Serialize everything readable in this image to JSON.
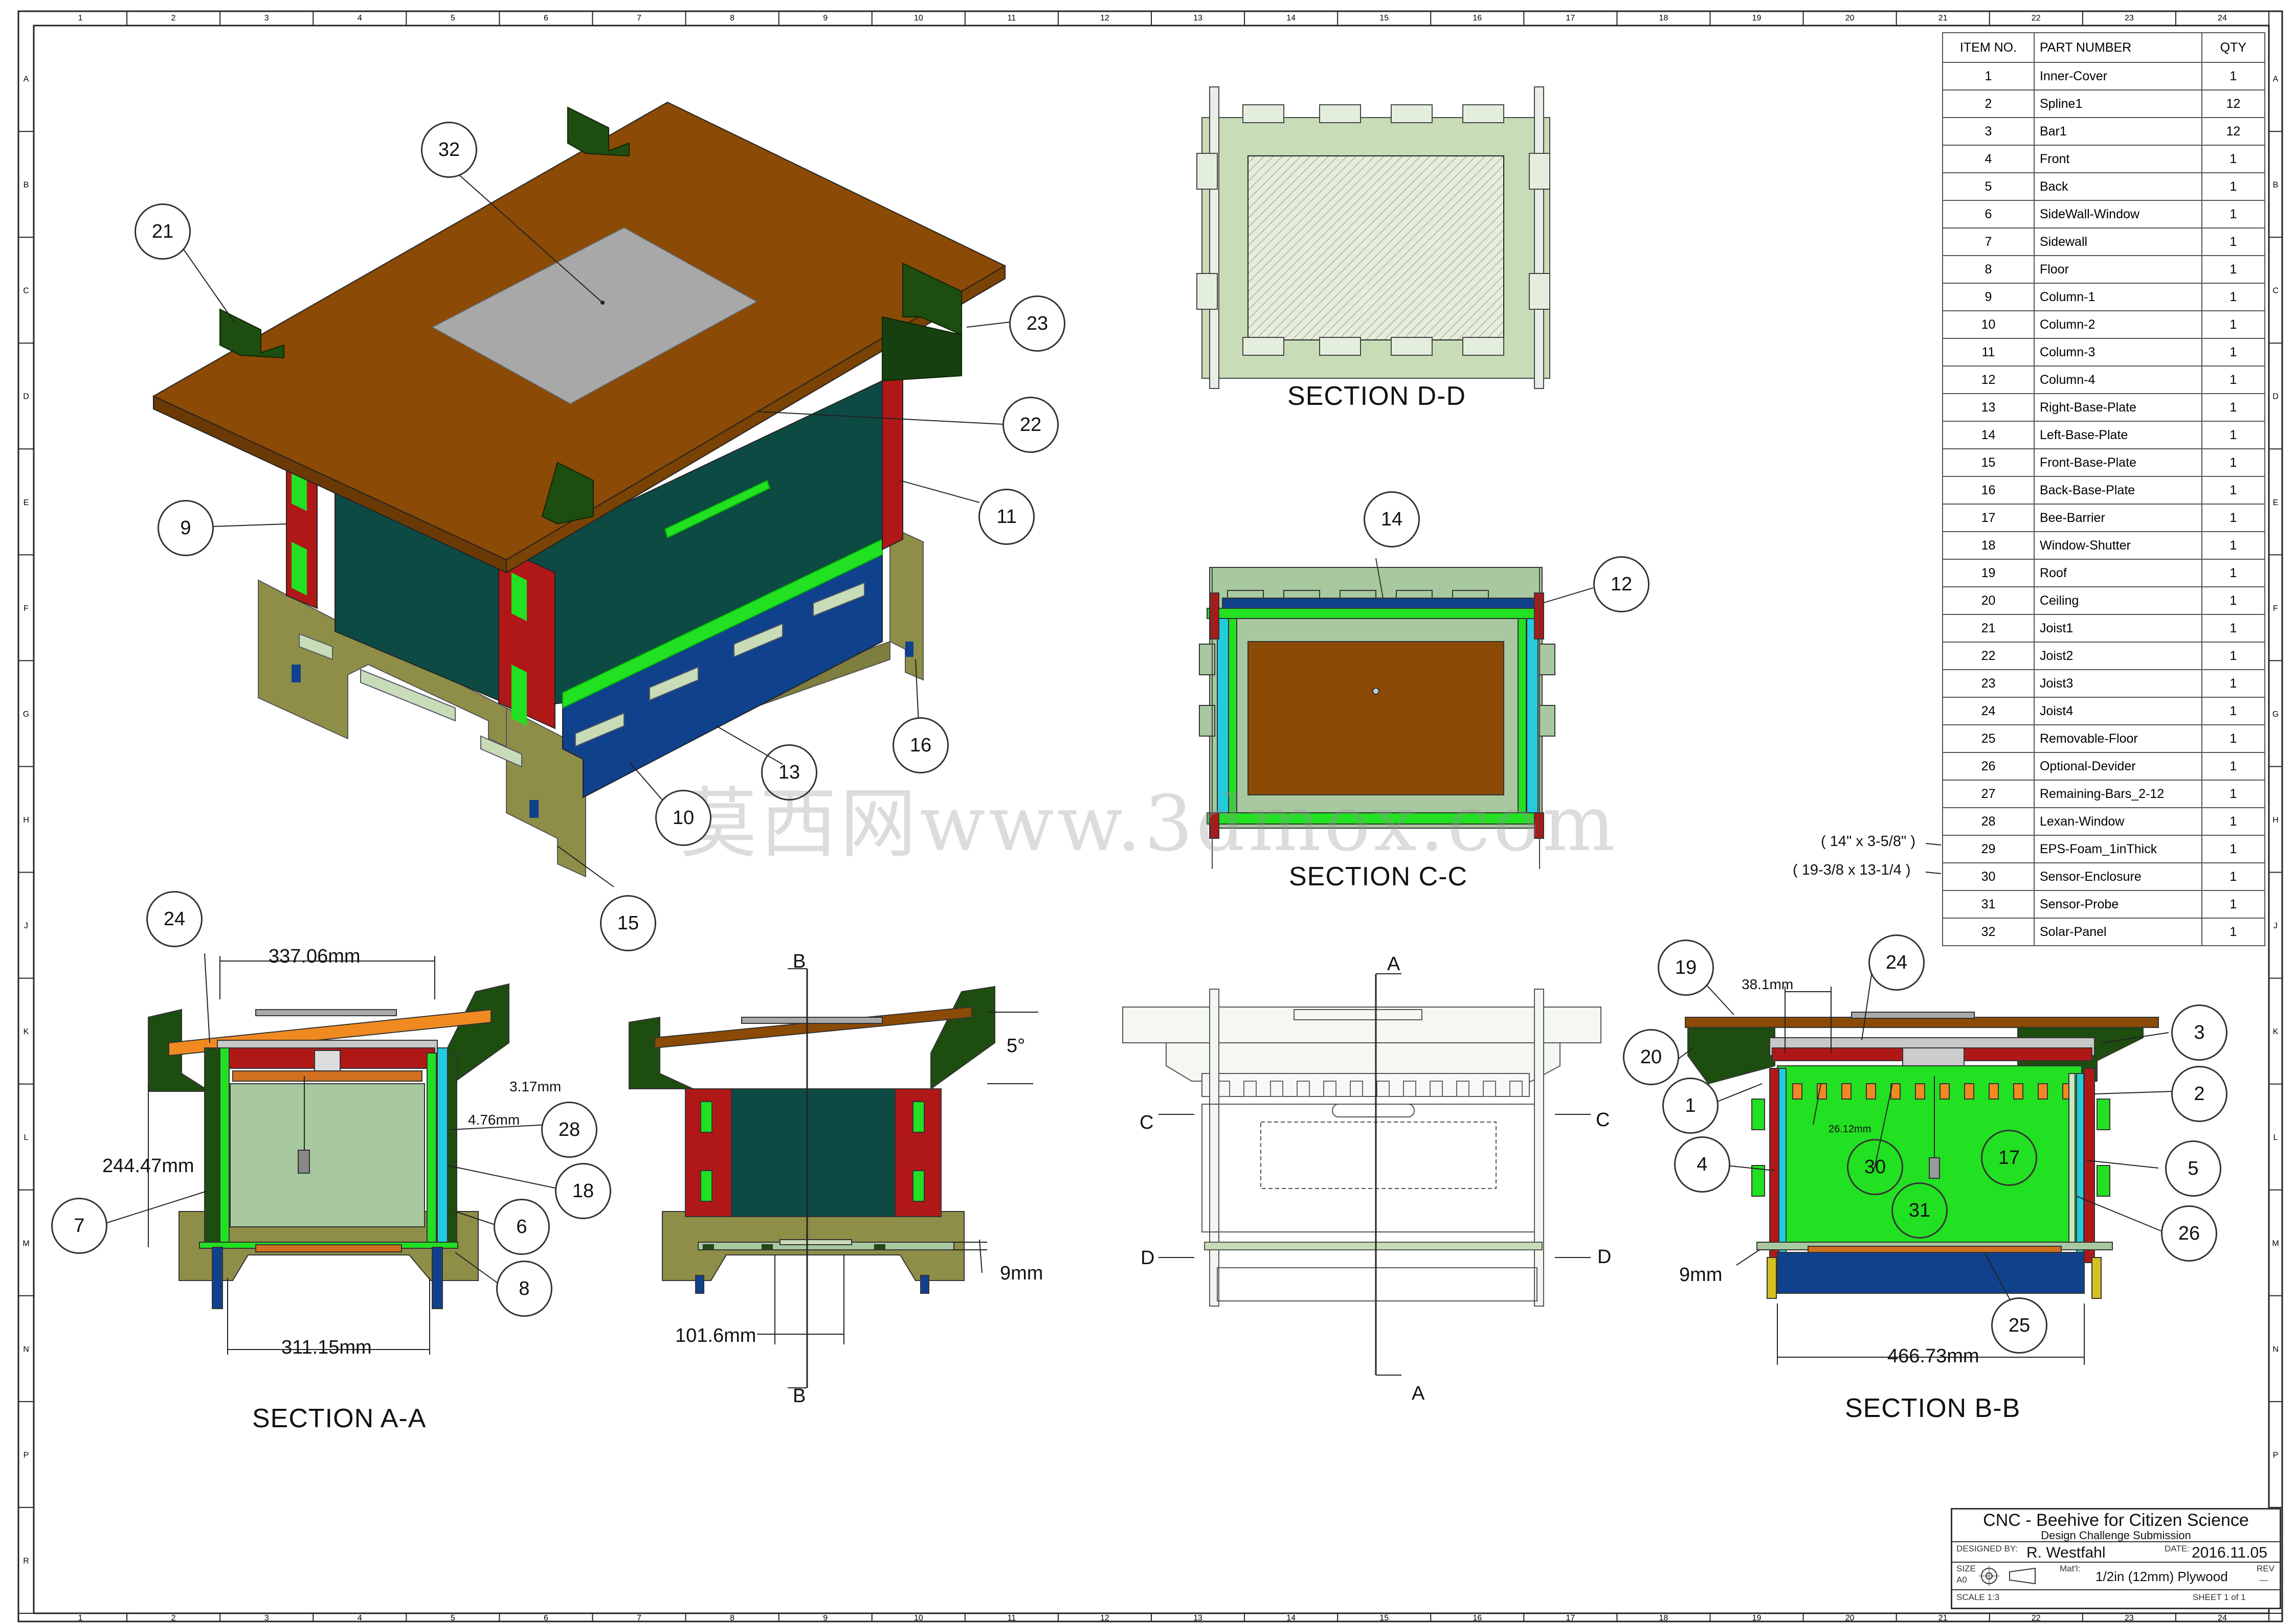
{
  "drawing": {
    "watermark": "莫西网www.3dmox.com",
    "border_cols": [
      "1",
      "2",
      "3",
      "4",
      "5",
      "6",
      "7",
      "8",
      "9",
      "10",
      "11",
      "12",
      "13",
      "14",
      "15",
      "16",
      "17",
      "18",
      "19",
      "20",
      "21",
      "22",
      "23",
      "24"
    ],
    "border_rows": [
      "A",
      "B",
      "C",
      "D",
      "E",
      "F",
      "G",
      "H",
      "J",
      "K",
      "L",
      "M",
      "N",
      "P",
      "R"
    ]
  },
  "sections": {
    "dd": "SECTION D-D",
    "cc": "SECTION C-C",
    "aa": "SECTION A-A",
    "bb": "SECTION B-B"
  },
  "iso_bubbles": [
    "32",
    "21",
    "23",
    "22",
    "9",
    "11",
    "16",
    "13",
    "10",
    "15"
  ],
  "cc_bubbles": [
    "14",
    "12"
  ],
  "aa_bubbles": [
    "24",
    "28",
    "18",
    "7",
    "6",
    "8"
  ],
  "bb_bubbles": [
    "19",
    "24",
    "3",
    "20",
    "1",
    "2",
    "4",
    "5",
    "30",
    "17",
    "31",
    "26",
    "25"
  ],
  "dimensions": {
    "aa_top": "337.06mm",
    "aa_gap": "3.17mm",
    "aa_wall": "4.76mm",
    "aa_height": "244.47mm",
    "aa_bottom": "311.15mm",
    "side_angle": "5°",
    "side_gap": "9mm",
    "side_width": "101.6mm",
    "bb_left": "38.1mm",
    "bb_pitch": "26.12mm",
    "bb_gap": "9mm",
    "bb_bottom": "466.73mm"
  },
  "cut_labels": {
    "b_top": "B",
    "b_bottom": "B",
    "a_top": "A",
    "a_bottom": "A",
    "c_left": "C",
    "c_right": "C",
    "d_left": "D",
    "d_right": "D"
  },
  "bom": {
    "headers": [
      "ITEM NO.",
      "PART NUMBER",
      "QTY"
    ],
    "rows": [
      [
        "1",
        "Inner-Cover",
        "1"
      ],
      [
        "2",
        "Spline1",
        "12"
      ],
      [
        "3",
        "Bar1",
        "12"
      ],
      [
        "4",
        "Front",
        "1"
      ],
      [
        "5",
        "Back",
        "1"
      ],
      [
        "6",
        "SideWall-Window",
        "1"
      ],
      [
        "7",
        "Sidewall",
        "1"
      ],
      [
        "8",
        "Floor",
        "1"
      ],
      [
        "9",
        "Column-1",
        "1"
      ],
      [
        "10",
        "Column-2",
        "1"
      ],
      [
        "11",
        "Column-3",
        "1"
      ],
      [
        "12",
        "Column-4",
        "1"
      ],
      [
        "13",
        "Right-Base-Plate",
        "1"
      ],
      [
        "14",
        "Left-Base-Plate",
        "1"
      ],
      [
        "15",
        "Front-Base-Plate",
        "1"
      ],
      [
        "16",
        "Back-Base-Plate",
        "1"
      ],
      [
        "17",
        "Bee-Barrier",
        "1"
      ],
      [
        "18",
        "Window-Shutter",
        "1"
      ],
      [
        "19",
        "Roof",
        "1"
      ],
      [
        "20",
        "Ceiling",
        "1"
      ],
      [
        "21",
        "Joist1",
        "1"
      ],
      [
        "22",
        "Joist2",
        "1"
      ],
      [
        "23",
        "Joist3",
        "1"
      ],
      [
        "24",
        "Joist4",
        "1"
      ],
      [
        "25",
        "Removable-Floor",
        "1"
      ],
      [
        "26",
        "Optional-Devider",
        "1"
      ],
      [
        "27",
        "Remaining-Bars_2-12",
        "1"
      ],
      [
        "28",
        "Lexan-Window",
        "1"
      ],
      [
        "29",
        "EPS-Foam_1inThick",
        "1"
      ],
      [
        "30",
        "Sensor-Enclosure",
        "1"
      ],
      [
        "31",
        "Sensor-Probe",
        "1"
      ],
      [
        "32",
        "Solar-Panel",
        "1"
      ]
    ],
    "note_28": "( 14\" x 3-5/8\" )",
    "note_29": "( 19-3/8 x 13-1/4 )"
  },
  "title_block": {
    "title": "CNC - Beehive for Citizen Science",
    "subtitle": "Design Challenge Submission",
    "designed_by_label": "DESIGNED BY:",
    "designer": "R. Westfahl",
    "date_label": "DATE:",
    "date": "2016.11.05",
    "size_label": "SIZE",
    "size": "A0",
    "matl_label": "Mat'l:",
    "material": "1/2in (12mm) Plywood",
    "rev_label": "REV",
    "rev": "—",
    "scale": "SCALE 1:3",
    "sheet": "SHEET 1 of 1"
  },
  "colors": {
    "roof": "#8B4A05",
    "joist": "#1E4D10",
    "base": "#8E8E48",
    "column": "#B01818",
    "glass": "#0E4A44",
    "window_green": "#22E022",
    "blue": "#10418C",
    "solar": "#A8A8A8",
    "light_green": "#A8C8A0"
  }
}
